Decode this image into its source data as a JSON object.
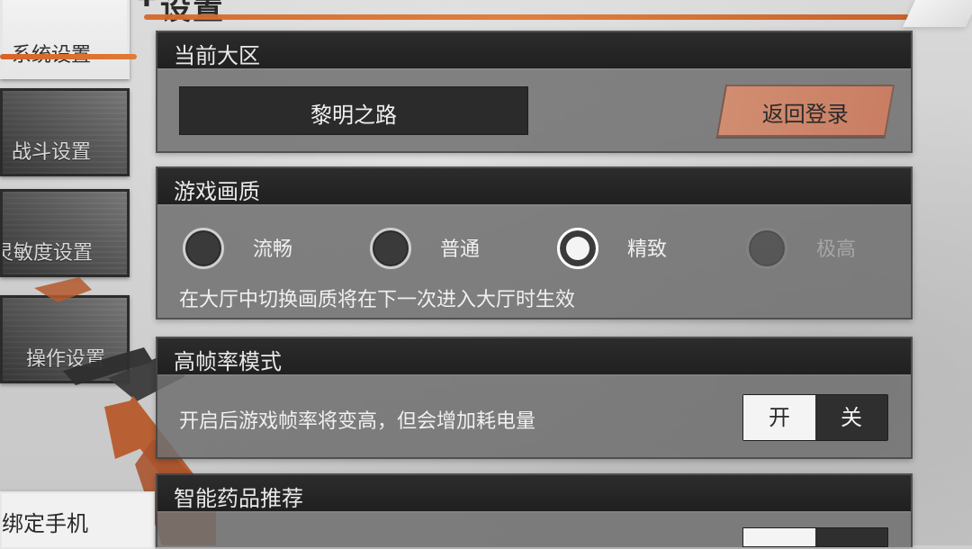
{
  "header": {
    "title": "设置"
  },
  "sidebar": {
    "items": [
      {
        "label": "系统设置"
      },
      {
        "label": "战斗设置"
      },
      {
        "label": "灵敏度设置"
      },
      {
        "label": "操作设置"
      }
    ],
    "bind_phone": "绑定手机"
  },
  "panels": {
    "server": {
      "title": "当前大区",
      "value": "黎明之路",
      "return_button": "返回登录"
    },
    "quality": {
      "title": "游戏画质",
      "options": [
        {
          "label": "流畅",
          "state": "unchecked"
        },
        {
          "label": "普通",
          "state": "unchecked"
        },
        {
          "label": "精致",
          "state": "checked"
        },
        {
          "label": "极高",
          "state": "disabled"
        }
      ],
      "note": "在大厅中切换画质将在下一次进入大厅时生效"
    },
    "high_fps": {
      "title": "高帧率模式",
      "desc": "开启后游戏帧率将变高，但会增加耗电量",
      "toggle": {
        "on": "开",
        "off": "关",
        "selected": "开"
      }
    },
    "smart_meds": {
      "title": "智能药品推荐"
    }
  }
}
